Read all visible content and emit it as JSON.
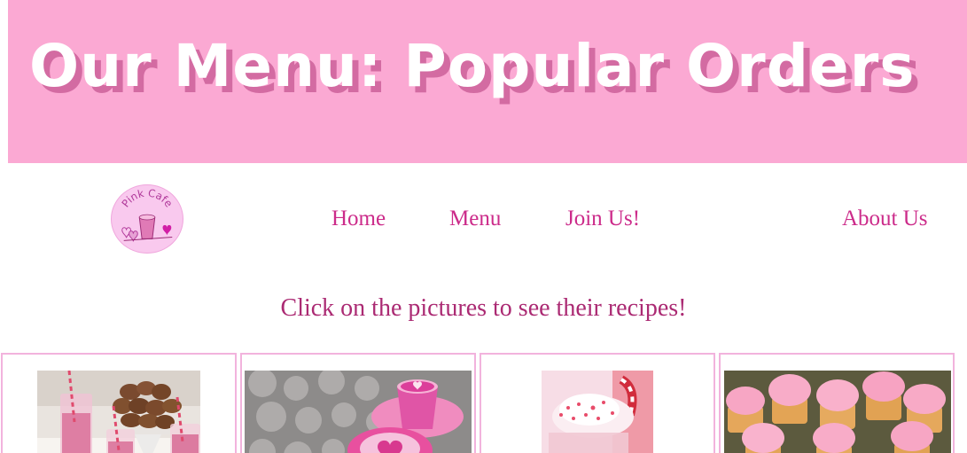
{
  "header": {
    "title": "Our Menu: Popular Orders"
  },
  "logo": {
    "text": "Pink Cafe",
    "icon": "smoothie-cup-logo"
  },
  "nav": {
    "items": [
      {
        "label": "Home"
      },
      {
        "label": "Menu"
      },
      {
        "label": "Join Us!"
      },
      {
        "label": "About Us"
      }
    ]
  },
  "main": {
    "instruction": "Click on the pictures to see their recipes!"
  },
  "gallery": {
    "items": [
      {
        "subject": "pink smoothies and muffins"
      },
      {
        "subject": "pink latte with heart art"
      },
      {
        "subject": "peppermint milkshake"
      },
      {
        "subject": "pink frosted cupcakes"
      }
    ]
  },
  "colors": {
    "banner_bg": "#fba9d3",
    "banner_text": "#ffffff",
    "banner_text_shadow": "#d36ba2",
    "nav_link": "#cc2b8a",
    "instruction_text": "#ab2a73",
    "card_border": "#f2b3dd"
  }
}
